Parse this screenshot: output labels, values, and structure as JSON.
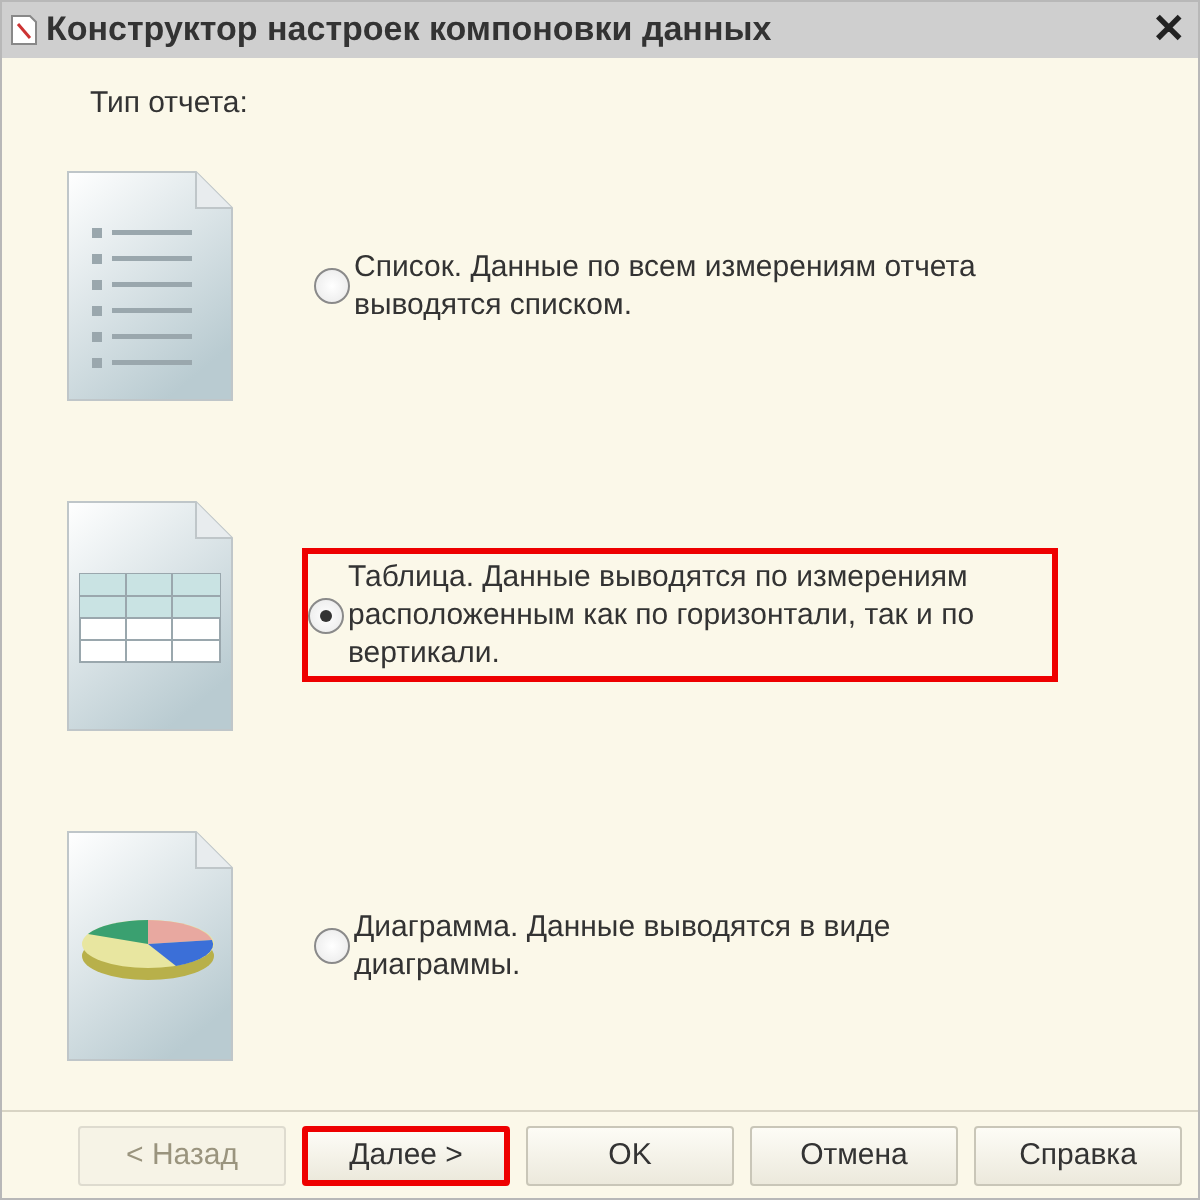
{
  "window": {
    "title": "Конструктор настроек компоновки данных",
    "close": "✕"
  },
  "label": "Тип отчета:",
  "options": [
    {
      "kind": "list",
      "text": "Список. Данные по всем измерениям отчета выводятся списком.",
      "selected": false,
      "highlighted": false
    },
    {
      "kind": "table",
      "text": "Таблица. Данные выводятся по измерениям расположенным как по горизонтали, так и по вертикали.",
      "selected": true,
      "highlighted": true
    },
    {
      "kind": "pie",
      "text": "Диаграмма. Данные выводятся в виде диаграммы.",
      "selected": false,
      "highlighted": false
    }
  ],
  "buttons": [
    {
      "label": "< Назад",
      "disabled": true,
      "highlighted": false
    },
    {
      "label": "Далее >",
      "disabled": false,
      "highlighted": true
    },
    {
      "label": "OK",
      "disabled": false,
      "highlighted": false
    },
    {
      "label": "Отмена",
      "disabled": false,
      "highlighted": false
    },
    {
      "label": "Справка",
      "disabled": false,
      "highlighted": false
    }
  ]
}
